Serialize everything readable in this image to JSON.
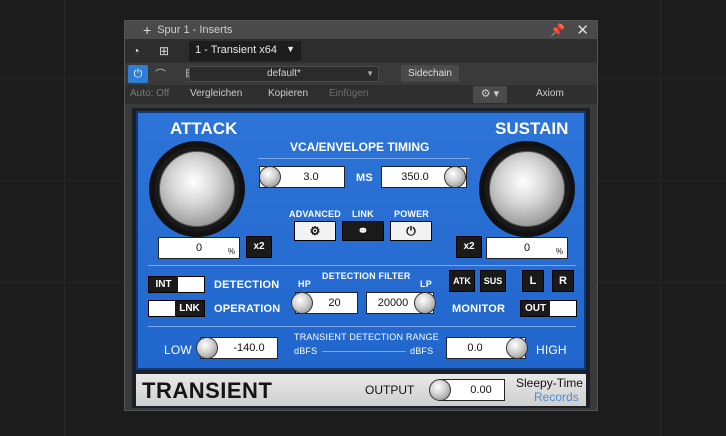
{
  "window": {
    "title": "Spur 1 - Inserts",
    "plugin_name": "1 - Transient x64",
    "preset": "default*",
    "sidechain_label": "Sidechain",
    "auto_label": "Auto: Off",
    "compare_label": "Vergleichen",
    "copy_label": "Kopieren",
    "paste_label": "Einfügen",
    "preset_bank": "Axiom"
  },
  "plugin": {
    "attack": {
      "title": "ATTACK",
      "value": "0",
      "unit": "%",
      "x2": "x2"
    },
    "sustain": {
      "title": "SUSTAIN",
      "value": "0",
      "unit": "%",
      "x2": "x2"
    },
    "timing": {
      "title": "VCA/ENVELOPE TIMING",
      "left_value": "3.0",
      "unit": "MS",
      "right_value": "350.0"
    },
    "buttons": {
      "advanced": "ADVANCED",
      "link": "LINK",
      "power": "POWER"
    },
    "detection": {
      "int": "INT",
      "label": "DETECTION",
      "lnk": "LNK",
      "operation": "OPERATION"
    },
    "filter": {
      "title": "DETECTION FILTER",
      "hp": "HP",
      "lp": "LP",
      "hp_value": "20",
      "lp_value": "20000"
    },
    "monitor": {
      "atk": "ATK",
      "sus": "SUS",
      "l": "L",
      "r": "R",
      "label": "MONITOR",
      "out": "OUT"
    },
    "range": {
      "title": "TRANSIENT DETECTION RANGE",
      "unit_left": "dBFS",
      "unit_right": "dBFS",
      "low_label": "LOW",
      "low_value": "-140.0",
      "high_label": "HIGH",
      "high_value": "0.0"
    },
    "footer": {
      "brand": "TRANSIENT",
      "output_label": "OUTPUT",
      "output_value": "0.00",
      "maker_line1": "Sleepy-Time",
      "maker_line2": "Records"
    }
  }
}
